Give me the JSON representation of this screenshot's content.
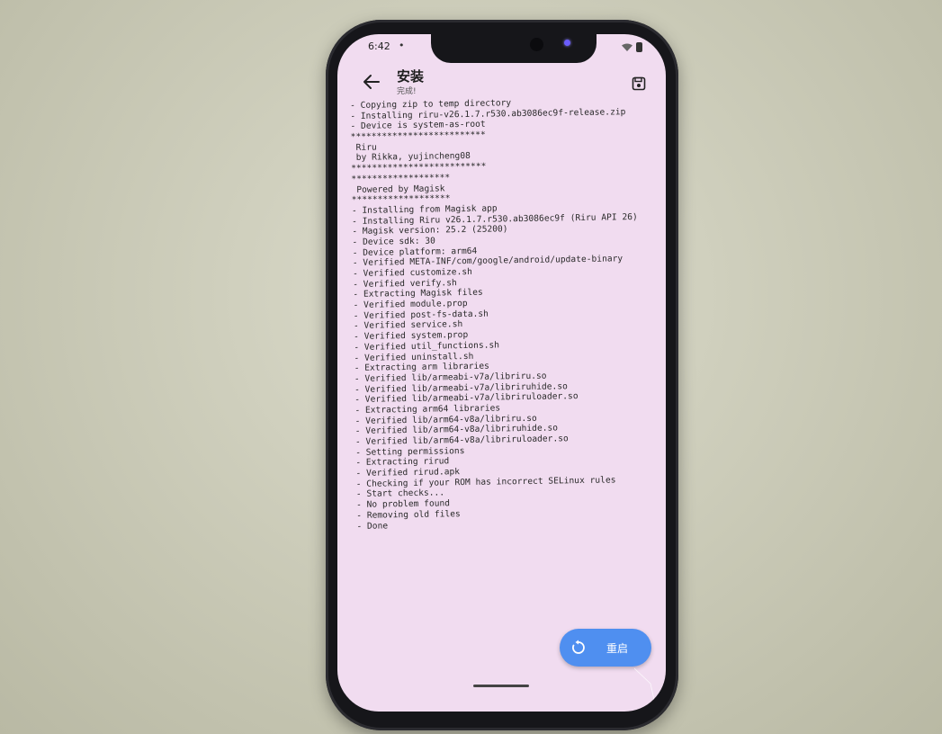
{
  "status_bar": {
    "time": "6:42",
    "dot": "•"
  },
  "app_bar": {
    "title": "安装",
    "subtitle": "完成!"
  },
  "icons": {
    "back": "back-arrow-icon",
    "save": "save-icon",
    "restart": "restart-icon",
    "wifi": "wifi-icon",
    "battery": "battery-icon"
  },
  "log": {
    "lines": [
      "- Copying zip to temp directory",
      "- Installing riru-v26.1.7.r530.ab3086ec9f-release.zip",
      "- Device is system-as-root",
      "**************************",
      " Riru",
      " by Rikka, yujincheng08",
      "**************************",
      "*******************",
      " Powered by Magisk",
      "*******************",
      "- Installing from Magisk app",
      "- Installing Riru v26.1.7.r530.ab3086ec9f (Riru API 26)",
      "- Magisk version: 25.2 (25200)",
      "- Device sdk: 30",
      "- Device platform: arm64",
      "- Verified META-INF/com/google/android/update-binary",
      "- Verified customize.sh",
      "- Verified verify.sh",
      "- Extracting Magisk files",
      "- Verified module.prop",
      "- Verified post-fs-data.sh",
      "- Verified service.sh",
      "- Verified system.prop",
      "- Verified util_functions.sh",
      "- Verified uninstall.sh",
      "- Extracting arm libraries",
      "- Verified lib/armeabi-v7a/libriru.so",
      "- Verified lib/armeabi-v7a/libriruhide.so",
      "- Verified lib/armeabi-v7a/libriruloader.so",
      "- Extracting arm64 libraries",
      "- Verified lib/arm64-v8a/libriru.so",
      "- Verified lib/arm64-v8a/libriruhide.so",
      "- Verified lib/arm64-v8a/libriruloader.so",
      "- Setting permissions",
      "- Extracting rirud",
      "- Verified rirud.apk",
      "- Checking if your ROM has incorrect SELinux rules",
      "- Start checks...",
      "- No problem found",
      "- Removing old files",
      "- Done"
    ]
  },
  "fab": {
    "label": "重启"
  },
  "colors": {
    "screen_bg": "#f1dcf0",
    "fab_bg": "#4f8ff0",
    "text": "#2a2a2a"
  }
}
